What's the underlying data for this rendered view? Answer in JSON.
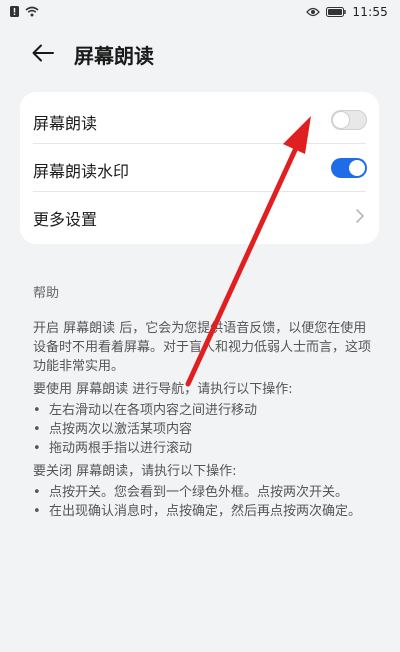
{
  "status_bar": {
    "time": "11:55"
  },
  "header": {
    "title": "屏幕朗读"
  },
  "settings": {
    "items": [
      {
        "label": "屏幕朗读",
        "toggle": "off"
      },
      {
        "label": "屏幕朗读水印",
        "toggle": "on"
      },
      {
        "label": "更多设置"
      }
    ]
  },
  "help": {
    "title": "帮助",
    "intro": "开启 屏幕朗读 后，它会为您提供语音反馈，以便您在使用设备时不用看着屏幕。对于盲人和视力低弱人士而言，这项功能非常实用。",
    "use_heading": "要使用 屏幕朗读 进行导航，请执行以下操作:",
    "use_items": [
      "左右滑动以在各项内容之间进行移动",
      "点按两次以激活某项内容",
      "拖动两根手指以进行滚动"
    ],
    "close_heading": "要关闭 屏幕朗读，请执行以下操作:",
    "close_items": [
      "点按开关。您会看到一个绿色外框。点按两次开关。",
      "在出现确认消息时，点按确定，然后再点按两次确定。"
    ],
    "bullet": "•"
  },
  "colors": {
    "accent": "#1e6ce8",
    "annotation_arrow": "#e02020",
    "background": "#f1f3f5"
  }
}
